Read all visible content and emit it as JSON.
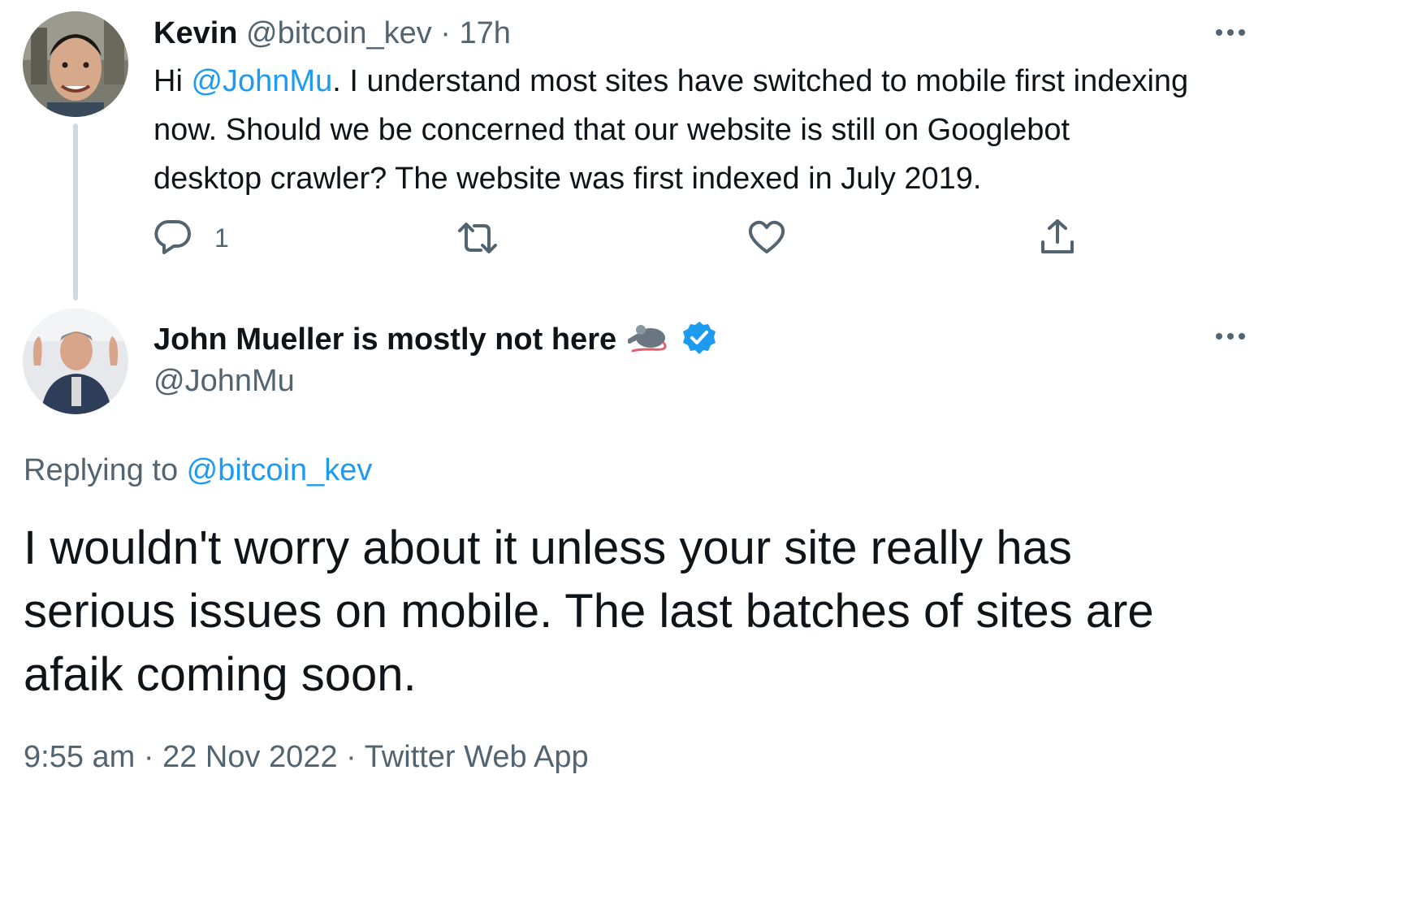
{
  "parent_tweet": {
    "display_name": "Kevin",
    "handle": "@bitcoin_kev",
    "separator": "·",
    "time_ago": "17h",
    "text_before": "Hi ",
    "mention": "@JohnMu",
    "text_after_line1": ". I understand most sites have switched to mobile first indexing",
    "text_line2": "now. Should we be concerned that our website is still on Googlebot",
    "text_line3": "desktop crawler? The website was first indexed in July 2019.",
    "actions": {
      "reply_icon": "reply-icon",
      "reply_count": "1",
      "retweet_icon": "retweet-icon",
      "like_icon": "heart-icon",
      "share_icon": "share-icon"
    }
  },
  "main_tweet": {
    "display_name": "John Mueller is mostly not here",
    "name_emoji": "rat-icon",
    "verified_icon": "verified-badge-icon",
    "handle": "@JohnMu",
    "replying_label": "Replying to ",
    "replying_handle": "@bitcoin_kev",
    "text_line1": "I wouldn't worry about it unless your site really has",
    "text_line2": "serious issues on mobile. The last batches of sites are",
    "text_line3": "afaik coming soon.",
    "time": "9:55 am",
    "sep1": "·",
    "date": "22 Nov 2022",
    "sep2": "·",
    "source": "Twitter Web App"
  },
  "colors": {
    "accent": "#1d9bf0",
    "muted": "#536471",
    "text": "#0f1419",
    "thread_line": "#cfd9de"
  }
}
